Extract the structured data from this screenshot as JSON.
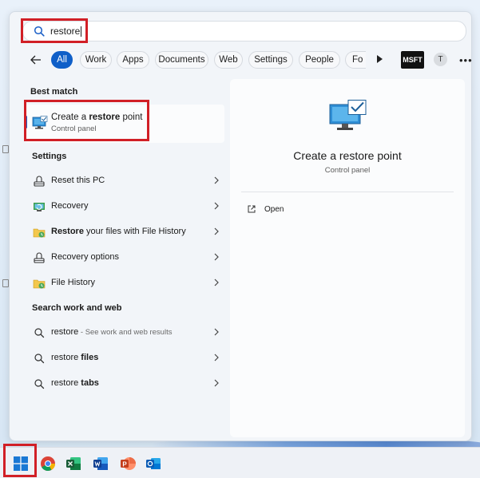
{
  "search": {
    "query": "restore"
  },
  "filters": {
    "items": [
      "All",
      "Work",
      "Apps",
      "Documents",
      "Web",
      "Settings",
      "People",
      "Fo"
    ],
    "account_badge": "MSFT",
    "avatar_initial": "T"
  },
  "best_match": {
    "heading": "Best match",
    "title_pre": "Create a ",
    "title_bold": "restore",
    "title_post": " point",
    "subtitle": "Control panel"
  },
  "settings": {
    "heading": "Settings",
    "items": [
      {
        "pre": "",
        "bold": "",
        "post": "Reset this PC",
        "icon": "reset-pc-icon"
      },
      {
        "pre": "",
        "bold": "",
        "post": "Recovery",
        "icon": "recovery-icon"
      },
      {
        "pre": "",
        "bold": "Restore",
        "post": " your files with File History",
        "icon": "file-history-icon"
      },
      {
        "pre": "",
        "bold": "",
        "post": "Recovery options",
        "icon": "recovery-options-icon"
      },
      {
        "pre": "",
        "bold": "",
        "post": "File History",
        "icon": "file-history-icon"
      }
    ]
  },
  "web": {
    "heading": "Search work and web",
    "items": [
      {
        "main": "restore",
        "bold": "",
        "muted": " - See work and web results"
      },
      {
        "main": "restore ",
        "bold": "files",
        "muted": ""
      },
      {
        "main": "restore ",
        "bold": "tabs",
        "muted": ""
      }
    ]
  },
  "preview": {
    "title": "Create a restore point",
    "subtitle": "Control panel",
    "open_label": "Open"
  },
  "taskbar": {
    "apps": [
      "start-button",
      "chrome-icon",
      "excel-icon",
      "word-icon",
      "powerpoint-icon",
      "outlook-icon"
    ]
  },
  "colors": {
    "accent": "#0f5fc8",
    "highlight": "#d11f26"
  }
}
